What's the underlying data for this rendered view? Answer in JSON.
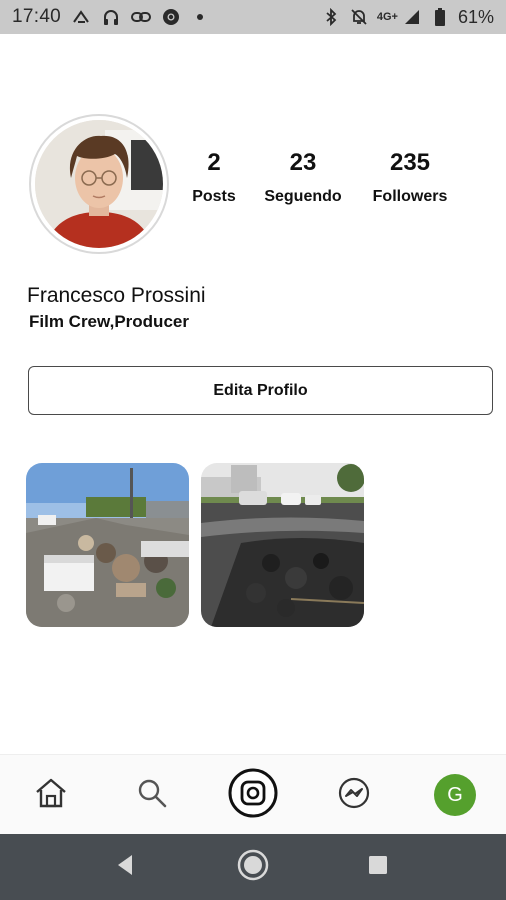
{
  "status_bar": {
    "time": "17:40",
    "network": "4G+",
    "battery": "61%",
    "left_icons": [
      "nfc-icon",
      "headphones-icon",
      "link-icon",
      "chrome-icon",
      "dot-icon"
    ],
    "right_icons": [
      "bluetooth-icon",
      "mute-icon",
      "signal-icon",
      "battery-icon"
    ]
  },
  "profile": {
    "name": "Francesco Prossini",
    "bio": "Film Crew,Producer",
    "stats": [
      {
        "value": "2",
        "label": "Posts"
      },
      {
        "value": "23",
        "label": "Seguendo"
      },
      {
        "value": "235",
        "label": "Followers"
      }
    ],
    "edit_button_label": "Edita Profilo"
  },
  "posts": [
    {
      "subject": "roadside-trash-photo"
    },
    {
      "subject": "damaged-road-photo"
    }
  ],
  "bottom_nav": {
    "items": [
      "home-icon",
      "search-icon",
      "new-post-icon",
      "messenger-icon",
      "profile-avatar"
    ],
    "profile_initial": "G",
    "profile_color": "#55a02d"
  },
  "system_nav": {
    "items": [
      "back-icon",
      "home-circle-icon",
      "recents-icon"
    ]
  }
}
